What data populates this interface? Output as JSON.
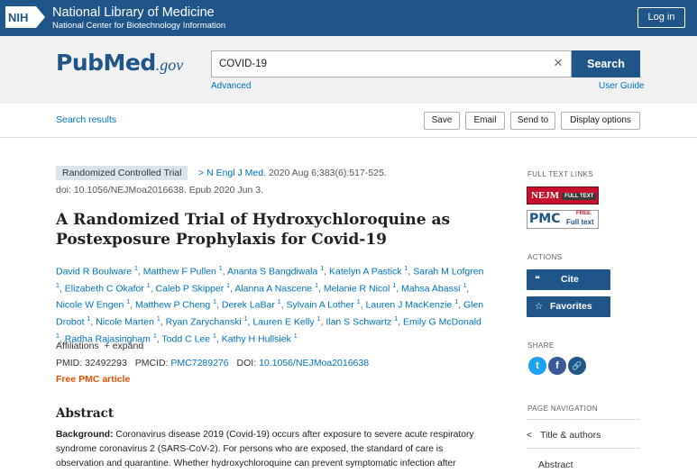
{
  "nih": {
    "logo_text": "NIH",
    "title": "National Library of Medicine",
    "subtitle": "National Center for Biotechnology Information",
    "login": "Log in"
  },
  "search": {
    "logo_pub": "Pub",
    "logo_med": "Med",
    "logo_gov": ".gov",
    "query": "COVID-19",
    "clear_icon": "×",
    "button": "Search",
    "advanced": "Advanced",
    "user_guide": "User Guide"
  },
  "toolbar": {
    "search_results": "Search results",
    "save": "Save",
    "email": "Email",
    "send_to": "Send to",
    "display_options": "Display options"
  },
  "article": {
    "pub_type": "Randomized Controlled Trial",
    "chevron": ">",
    "journal": "N Engl J Med.",
    "citation": " 2020 Aug 6;383(6):517-525.",
    "doi_epub": "doi: 10.1056/NEJMoa2016638. Epub 2020 Jun 3.",
    "title": "A Randomized Trial of Hydroxychloroquine as Postexposure Prophylaxis for Covid-19",
    "authors": [
      "David R Boulware",
      "Matthew F Pullen",
      "Ananta S Bangdiwala",
      "Katelyn A Pastick",
      "Sarah M Lofgren",
      "Elizabeth C Okafor",
      "Caleb P Skipper",
      "Alanna A Nascene",
      "Melanie R Nicol",
      "Mahsa Abassi",
      "Nicole W Engen",
      "Matthew P Cheng",
      "Derek LaBar",
      "Sylvain A Lother",
      "Lauren J MacKenzie",
      "Glen Drobot",
      "Nicole Marten",
      "Ryan Zarychanski",
      "Lauren E Kelly",
      "Ilan S Schwartz",
      "Emily G McDonald",
      "Radha Rajasingham",
      "Todd C Lee",
      "Kathy H Hullsiek"
    ],
    "affiliation_sup": "1",
    "affiliations": "Affiliations",
    "expand": "+ expand",
    "pmid_label": "PMID: 32492293",
    "pmcid_label": "PMCID: ",
    "pmcid": "PMC7289276",
    "doi_label": "DOI: ",
    "doi": "10.1056/NEJMoa2016638",
    "free_pmc": "Free PMC article",
    "abstract_heading": "Abstract",
    "abstract_bg_label": "Background:",
    "abstract_text": " Coronavirus disease 2019 (Covid-19) occurs after exposure to severe acute respiratory syndrome coronavirus 2 (SARS-CoV-2). For persons who are exposed, the standard of care is observation and quarantine. Whether hydroxychloroquine can prevent symptomatic infection after"
  },
  "sidebar": {
    "full_text_links": "FULL TEXT LINKS",
    "nejm": "NEJM",
    "nejm_full": "FULL TEXT",
    "pmc": "PMC",
    "pmc_free": "FREE",
    "pmc_full": "Full text",
    "actions": "ACTIONS",
    "cite_icon": "❝",
    "cite": "Cite",
    "fav_icon": "☆",
    "favorites": "Favorites",
    "share": "SHARE",
    "share_twitter": "t",
    "share_facebook": "f",
    "share_link": "🔗",
    "page_navigation": "PAGE NAVIGATION",
    "nav_chevron": "<",
    "nav_title": "Title & authors",
    "nav_abstract": "Abstract"
  },
  "colors": {
    "nih_blue": "#20558a",
    "link_blue": "#0071bc",
    "free_orange": "#e65100",
    "twitter": "#1da1f2",
    "facebook": "#3b5998",
    "link_icon": "#20558a"
  }
}
